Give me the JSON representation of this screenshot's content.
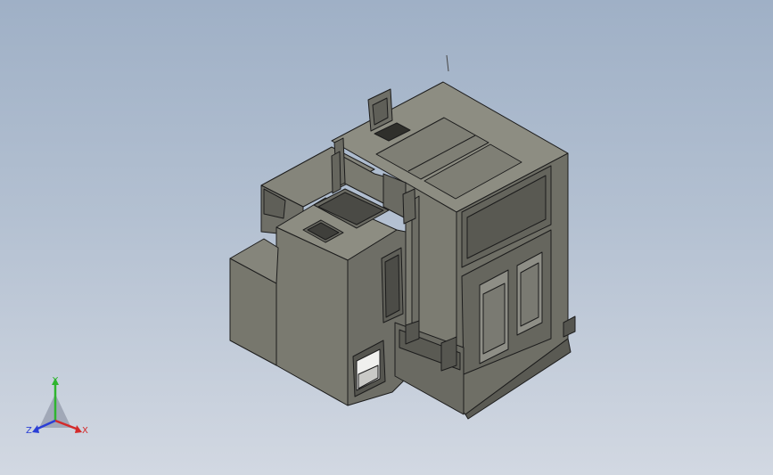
{
  "viewport": {
    "background_top": "#9fb0c6",
    "background_bottom": "#d2d8e2",
    "model_face_light": "#8a8a7f",
    "model_face_mid": "#77776d",
    "model_face_dark": "#5f5f58",
    "edge_color": "#1c1c1c"
  },
  "triad": {
    "x_label": "X",
    "y_label": "Y",
    "z_label": "Z",
    "x_color": "#d42a2a",
    "y_color": "#2fb52f",
    "z_color": "#2b3fd6"
  }
}
